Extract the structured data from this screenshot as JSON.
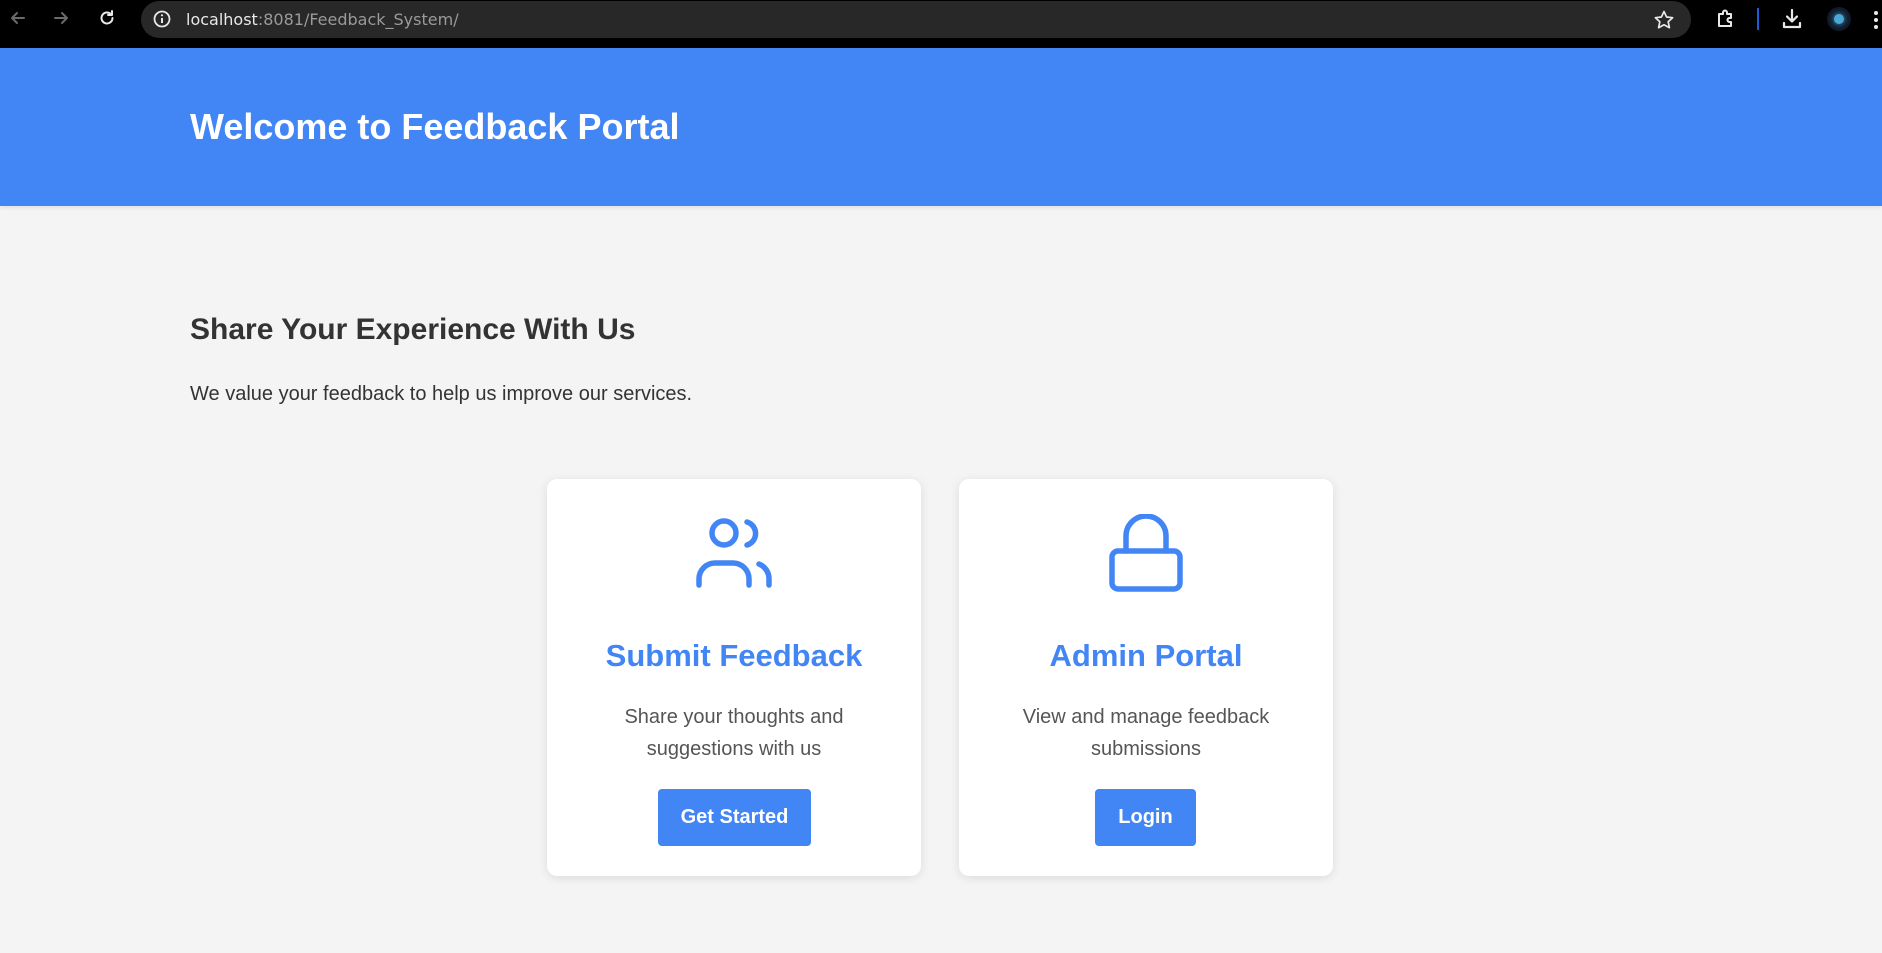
{
  "browser": {
    "url_host": "localhost",
    "url_path": ":8081/Feedback_System/"
  },
  "header": {
    "title": "Welcome to Feedback Portal"
  },
  "intro": {
    "title": "Share Your Experience With Us",
    "subtitle": "We value your feedback to help us improve our services."
  },
  "cards": [
    {
      "icon": "users-icon",
      "title": "Submit Feedback",
      "description": "Share your thoughts and suggestions with us",
      "button_label": "Get Started"
    },
    {
      "icon": "lock-icon",
      "title": "Admin Portal",
      "description": "View and manage feedback submissions",
      "button_label": "Login"
    }
  ],
  "colors": {
    "primary": "#4285f4",
    "background": "#f4f4f4",
    "text": "#333333"
  }
}
